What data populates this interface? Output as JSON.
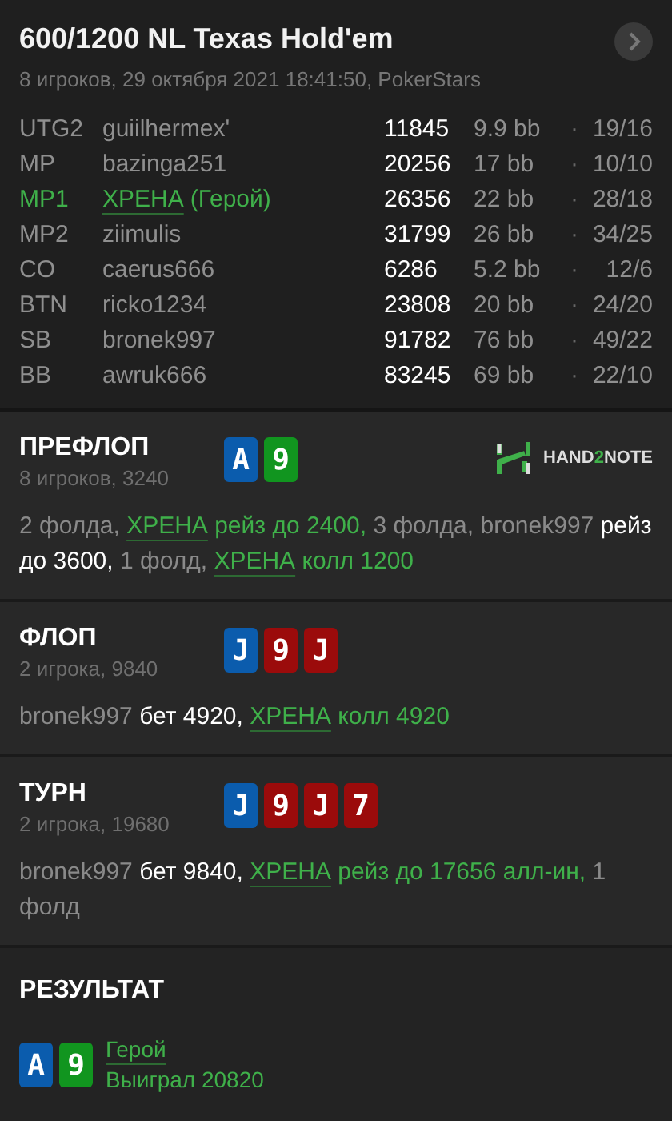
{
  "header": {
    "title": "600/1200 NL Texas Hold'em",
    "subtitle": "8 игроков, 29 октября 2021 18:41:50, PokerStars"
  },
  "players": [
    {
      "position": "UTG2",
      "name": "guiilhermex'",
      "stack": "11845",
      "bb": "9.9 bb",
      "dot": "·",
      "ratio": "19/16",
      "hero": false
    },
    {
      "position": "MP",
      "name": "bazinga251",
      "stack": "20256",
      "bb": "17 bb",
      "dot": "·",
      "ratio": "10/10",
      "hero": false
    },
    {
      "position": "MP1",
      "name": "ХРЕНА",
      "tag": "(Герой)",
      "stack": "26356",
      "bb": "22 bb",
      "dot": "·",
      "ratio": "28/18",
      "hero": true
    },
    {
      "position": "MP2",
      "name": "ziimulis",
      "stack": "31799",
      "bb": "26 bb",
      "dot": "·",
      "ratio": "34/25",
      "hero": false
    },
    {
      "position": "CO",
      "name": "caerus666",
      "stack": "6286",
      "bb": "5.2 bb",
      "dot": "·",
      "ratio": "12/6",
      "hero": false
    },
    {
      "position": "BTN",
      "name": "ricko1234",
      "stack": "23808",
      "bb": "20 bb",
      "dot": "·",
      "ratio": "24/20",
      "hero": false
    },
    {
      "position": "SB",
      "name": "bronek997",
      "stack": "91782",
      "bb": "76 bb",
      "dot": "·",
      "ratio": "49/22",
      "hero": false
    },
    {
      "position": "BB",
      "name": "awruk666",
      "stack": "83245",
      "bb": "69 bb",
      "dot": "·",
      "ratio": "22/10",
      "hero": false
    }
  ],
  "streets": [
    {
      "title": "ПРЕФЛОП",
      "info": "8 игроков, 3240",
      "cards": [
        {
          "rank": "A",
          "color": "#0b5cad"
        },
        {
          "rank": "9",
          "color": "#11951f"
        }
      ],
      "logo": {
        "parts": [
          {
            "text": "HAND",
            "accent": false
          },
          {
            "text": "2",
            "accent": true
          },
          {
            "text": "NOTE",
            "accent": false
          }
        ]
      },
      "actions": [
        {
          "kind": "muted",
          "text": "2 фолда,"
        },
        {
          "kind": "hero",
          "text": "ХРЕНА"
        },
        {
          "kind": "hero_bet",
          "text": "рейз до 2400,"
        },
        {
          "kind": "muted",
          "text": "3 фолда, bronek997"
        },
        {
          "kind": "bet",
          "text": "рейз до 3600,"
        },
        {
          "kind": "muted",
          "text": "1 фолд,"
        },
        {
          "kind": "hero",
          "text": "ХРЕНА"
        },
        {
          "kind": "hero_bet",
          "text": "колл 1200"
        }
      ]
    },
    {
      "title": "ФЛОП",
      "info": "2 игрока, 9840",
      "cards": [
        {
          "rank": "J",
          "color": "#0b5cad"
        },
        {
          "rank": "9",
          "color": "#9b0b0b"
        },
        {
          "rank": "J",
          "color": "#9b0b0b"
        }
      ],
      "actions": [
        {
          "kind": "muted",
          "text": "bronek997"
        },
        {
          "kind": "bet",
          "text": "бет 4920,"
        },
        {
          "kind": "hero",
          "text": "ХРЕНА"
        },
        {
          "kind": "hero_bet",
          "text": "колл 4920"
        }
      ]
    },
    {
      "title": "ТУРН",
      "info": "2 игрока, 19680",
      "cards": [
        {
          "rank": "J",
          "color": "#0b5cad"
        },
        {
          "rank": "9",
          "color": "#9b0b0b"
        },
        {
          "rank": "J",
          "color": "#9b0b0b"
        },
        {
          "rank": "7",
          "color": "#9b0b0b"
        }
      ],
      "actions": [
        {
          "kind": "muted",
          "text": "bronek997"
        },
        {
          "kind": "bet",
          "text": "бет 9840,"
        },
        {
          "kind": "hero",
          "text": "ХРЕНА"
        },
        {
          "kind": "hero_bet",
          "text": "рейз до 17656 алл-ин,"
        },
        {
          "kind": "muted",
          "text": "1 фолд"
        }
      ]
    }
  ],
  "result": {
    "title": "РЕЗУЛЬТАТ",
    "cards": [
      {
        "rank": "A",
        "color": "#0b5cad"
      },
      {
        "rank": "9",
        "color": "#11951f"
      }
    ],
    "player": "Герой",
    "outcome": "Выиграл 20820"
  }
}
